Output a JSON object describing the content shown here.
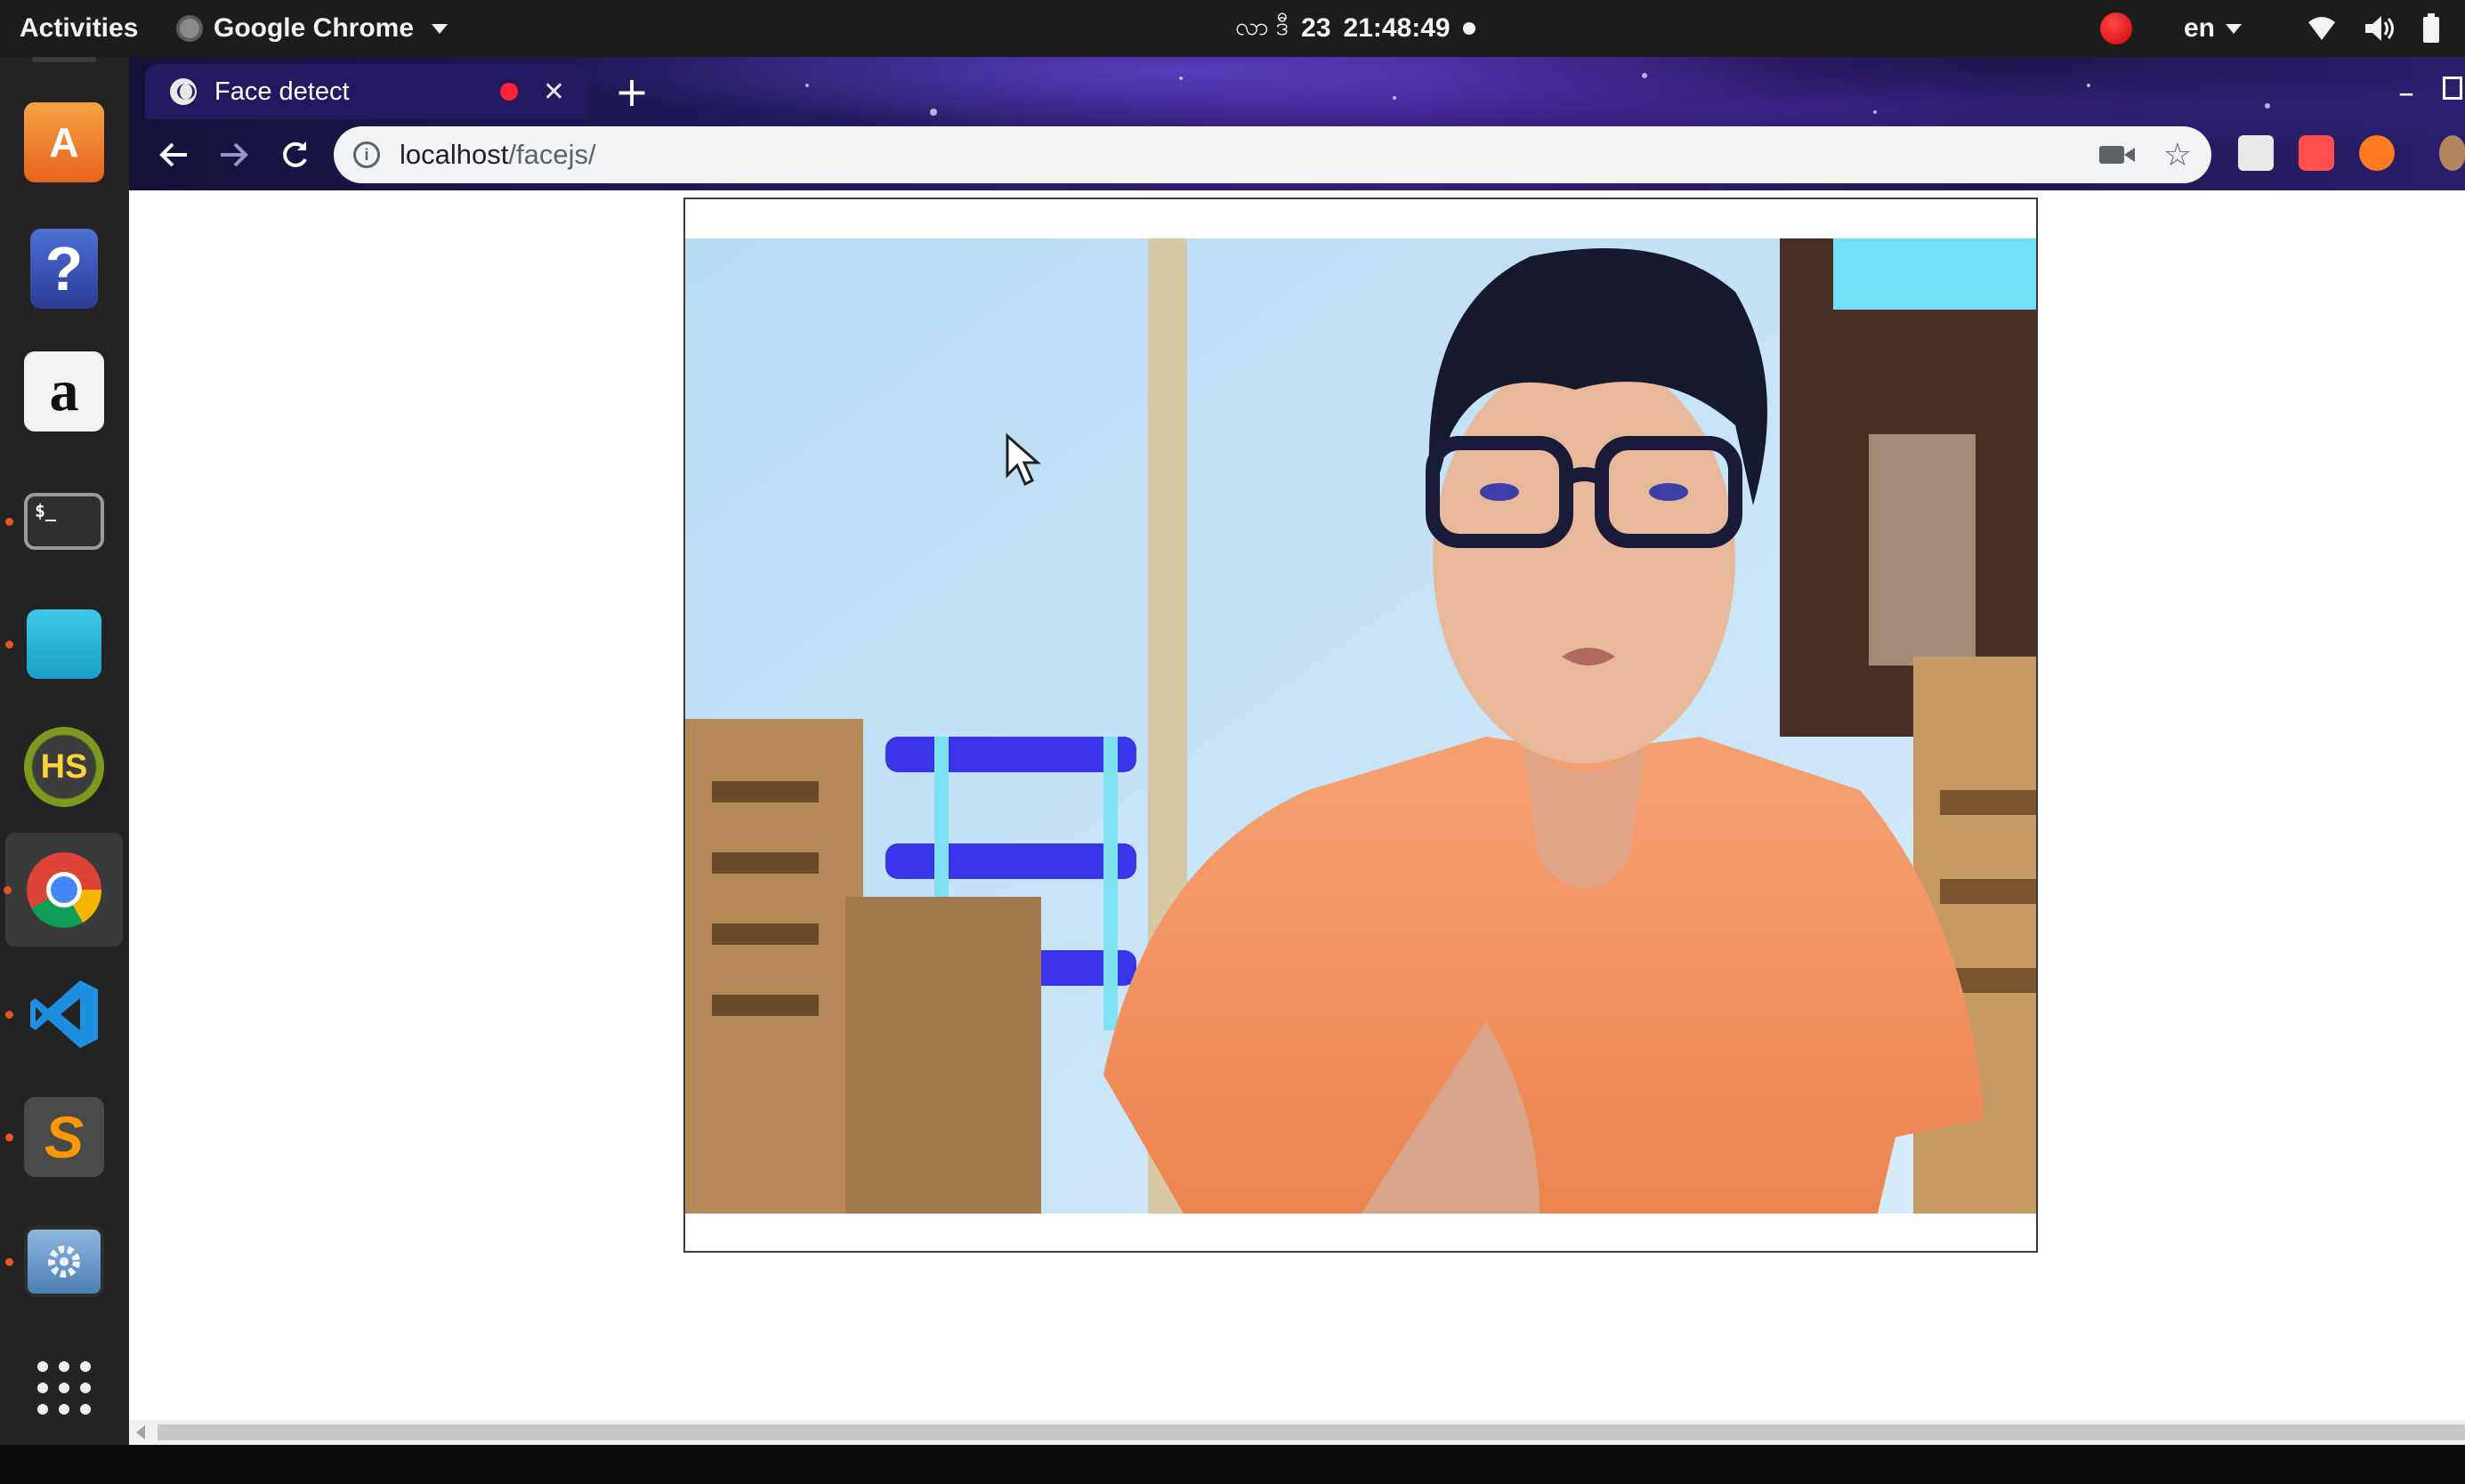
{
  "topbar": {
    "activities": "Activities",
    "app_name": "Google Chrome",
    "clock_prefix": "လာ ဒီ",
    "clock_date": "23",
    "clock_time": "21:48:49",
    "language": "en",
    "battery_partial": "2"
  },
  "dock": {
    "items": [
      {
        "name": "ubuntu-software",
        "label": "A",
        "running": false
      },
      {
        "name": "help",
        "label": "?",
        "running": false
      },
      {
        "name": "amazon",
        "label": "a",
        "running": false
      },
      {
        "name": "terminal",
        "label": "$_",
        "running": true
      },
      {
        "name": "files",
        "label": "",
        "running": true
      },
      {
        "name": "hs",
        "label": "HS",
        "running": false
      },
      {
        "name": "chrome",
        "label": "",
        "running": true,
        "active": true
      },
      {
        "name": "vscode",
        "label": "",
        "running": true
      },
      {
        "name": "sublime",
        "label": "S",
        "running": true
      },
      {
        "name": "remote-desktop",
        "label": "",
        "running": true
      },
      {
        "name": "show-applications",
        "label": "",
        "running": false
      }
    ]
  },
  "browser": {
    "tab_title": "Face detect",
    "new_tab": "+",
    "url_host": "localhost",
    "url_path": "/facejs/"
  },
  "colors": {
    "accent_running": "#e95420",
    "recording": "#ff2233",
    "shirt": "#f08d5c"
  }
}
